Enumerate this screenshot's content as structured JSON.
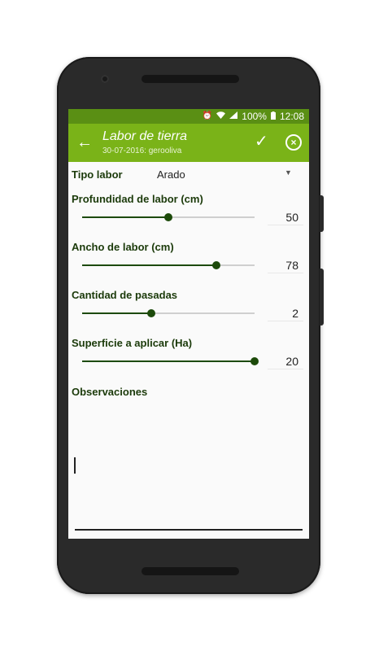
{
  "status_bar": {
    "battery": "100%",
    "time": "12:08"
  },
  "app_bar": {
    "title": "Labor de tierra",
    "subtitle": "30-07-2016: gerooliva"
  },
  "form": {
    "tipo_labor": {
      "label": "Tipo labor",
      "value": "Arado"
    },
    "sliders": [
      {
        "label": "Profundidad de labor (cm)",
        "value": "50",
        "fraction": 0.5
      },
      {
        "label": "Ancho de labor (cm)",
        "value": "78",
        "fraction": 0.78
      },
      {
        "label": "Cantidad de pasadas",
        "value": "2",
        "fraction": 0.4
      },
      {
        "label": "Superficie a aplicar (Ha)",
        "value": "20",
        "fraction": 1.0
      }
    ],
    "observaciones": {
      "label": "Observaciones",
      "value": ""
    }
  },
  "colors": {
    "status_bar": "#5a8f14",
    "app_bar": "#7ab318",
    "accent": "#1c4a0a"
  }
}
